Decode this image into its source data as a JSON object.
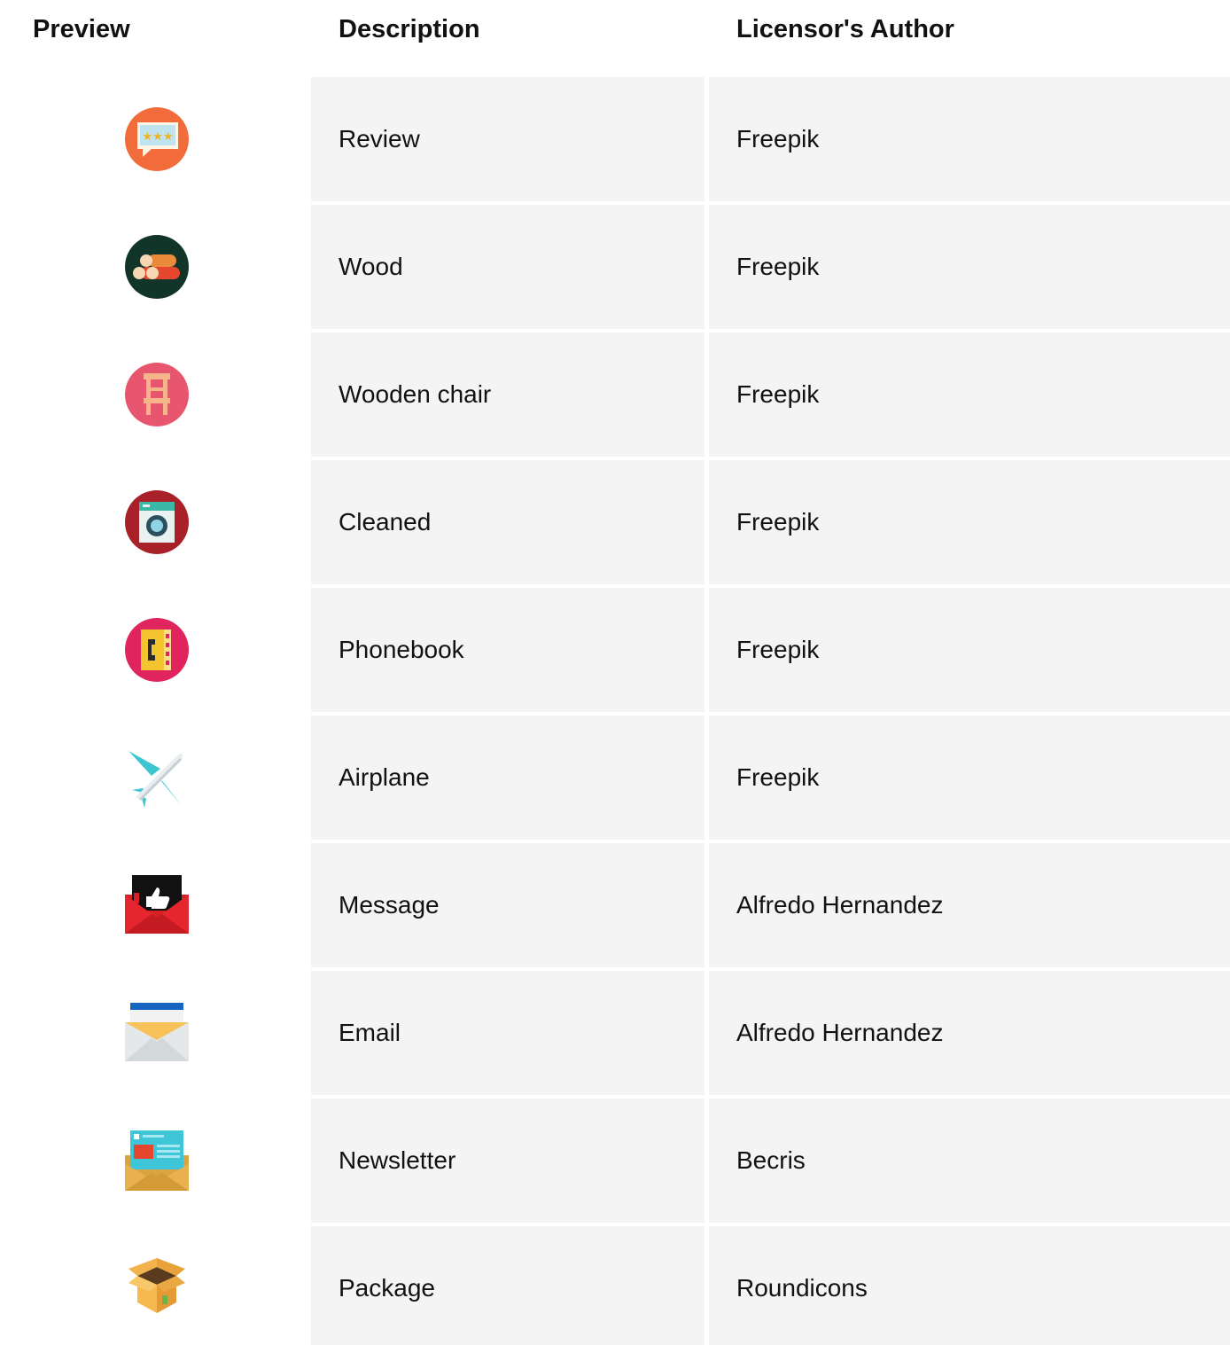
{
  "table": {
    "headers": {
      "preview": "Preview",
      "description": "Description",
      "author": "Licensor's Author"
    },
    "rows": [
      {
        "icon": "review-icon",
        "description": "Review",
        "author": "Freepik"
      },
      {
        "icon": "wood-icon",
        "description": "Wood",
        "author": "Freepik"
      },
      {
        "icon": "wooden-chair-icon",
        "description": "Wooden chair",
        "author": "Freepik"
      },
      {
        "icon": "washing-machine-icon",
        "description": "Cleaned",
        "author": "Freepik"
      },
      {
        "icon": "phonebook-icon",
        "description": "Phonebook",
        "author": "Freepik"
      },
      {
        "icon": "airplane-icon",
        "description": "Airplane",
        "author": "Freepik"
      },
      {
        "icon": "message-thumbs-up-icon",
        "description": "Message",
        "author": "Alfredo Hernandez"
      },
      {
        "icon": "email-envelope-icon",
        "description": "Email",
        "author": "Alfredo Hernandez"
      },
      {
        "icon": "newsletter-icon",
        "description": "Newsletter",
        "author": "Becris"
      },
      {
        "icon": "package-box-icon",
        "description": "Package",
        "author": "Roundicons"
      }
    ]
  },
  "colors": {
    "cell_background": "#f4f4f4",
    "text": "#111111"
  }
}
